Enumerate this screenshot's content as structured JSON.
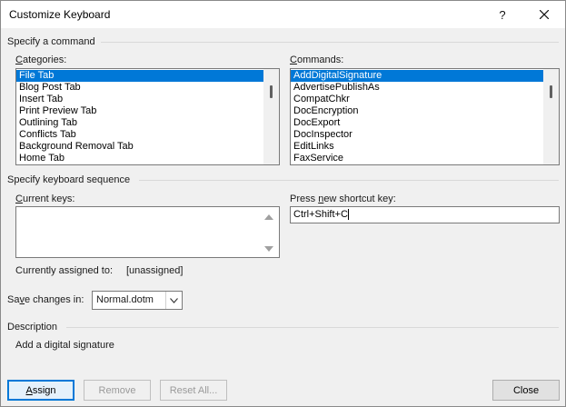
{
  "window": {
    "title": "Customize Keyboard",
    "help_glyph": "?",
    "close_icon": "close-icon"
  },
  "sections": {
    "command": "Specify a command",
    "keyboard": "Specify keyboard sequence",
    "description": "Description"
  },
  "categories": {
    "label_u": "C",
    "label_rest": "ategories:",
    "items": [
      {
        "label": "File Tab",
        "selected": true
      },
      {
        "label": "Blog Post Tab"
      },
      {
        "label": "Insert Tab"
      },
      {
        "label": "Print Preview Tab"
      },
      {
        "label": "Outlining Tab"
      },
      {
        "label": "Conflicts Tab"
      },
      {
        "label": "Background Removal Tab"
      },
      {
        "label": "Home Tab"
      }
    ]
  },
  "commands": {
    "label_u": "C",
    "label_rest": "ommands:",
    "items": [
      {
        "label": "AddDigitalSignature",
        "selected": true
      },
      {
        "label": "AdvertisePublishAs"
      },
      {
        "label": "CompatChkr"
      },
      {
        "label": "DocEncryption"
      },
      {
        "label": "DocExport"
      },
      {
        "label": "DocInspector"
      },
      {
        "label": "EditLinks"
      },
      {
        "label": "FaxService"
      }
    ]
  },
  "current_keys": {
    "label_u": "C",
    "label_rest": "urrent keys:"
  },
  "shortcut": {
    "label_pre": "Press ",
    "label_u": "n",
    "label_rest": "ew shortcut key:",
    "value": "Ctrl+Shift+C"
  },
  "assigned": {
    "label": "Currently assigned to:",
    "value": "[unassigned]"
  },
  "save_changes": {
    "label_pre": "Sa",
    "label_u": "v",
    "label_rest": "e changes in:",
    "value": "Normal.dotm"
  },
  "description": {
    "text": "Add a digital signature"
  },
  "buttons": {
    "assign_u": "A",
    "assign_rest": "ssign",
    "remove": "Remove",
    "reset_all": "Reset All...",
    "close": "Close"
  },
  "colors": {
    "selection": "#0078d7",
    "default_button_border": "#0078d7"
  }
}
